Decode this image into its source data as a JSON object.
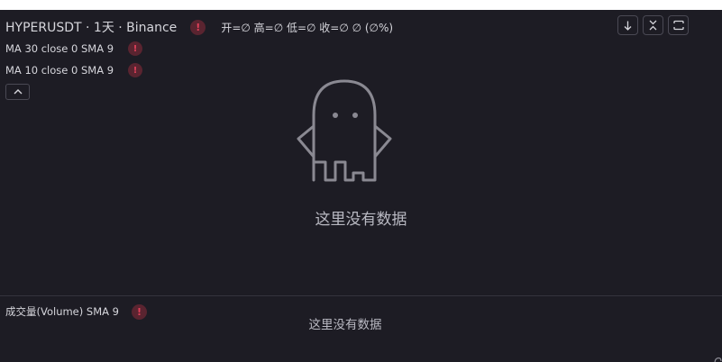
{
  "chart": {
    "symbol_title": "HYPERUSDT · 1天 · Binance",
    "ohlc_text": "开=∅ 高=∅ 低=∅ 收=∅ ∅ (∅%)",
    "warning_glyph": "!",
    "indicators": [
      {
        "label": "MA 30 close 0 SMA 9"
      },
      {
        "label": "MA 10 close 0 SMA 9"
      }
    ],
    "empty_message": "这里没有数据"
  },
  "volume": {
    "label": "成交量(Volume) SMA 9",
    "empty_message": "这里没有数据"
  },
  "toolbar": {
    "icons": [
      "arrow-down-icon",
      "collapse-icon",
      "maximize-icon",
      "chevron-up-icon"
    ]
  },
  "colors": {
    "background": "#1d1c24",
    "text": "#d6d6dc",
    "warning_bg": "#5a2430",
    "warning_fg": "#e0405a",
    "muted_text": "#b9b9c2"
  }
}
